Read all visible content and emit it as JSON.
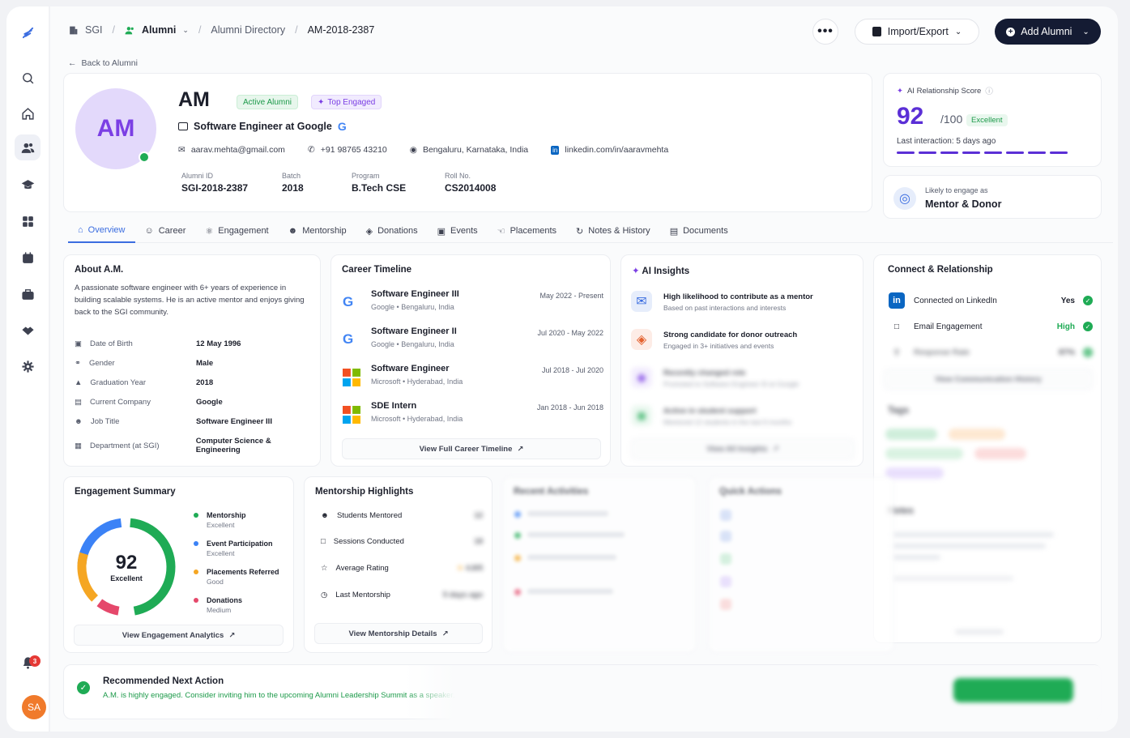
{
  "breadcrumb": {
    "org": "SGI",
    "section": "Alumni",
    "directory": "Alumni Directory",
    "current": "AM-2018-2387"
  },
  "toolbar": {
    "more": "•••",
    "import_export": "Import/Export",
    "add": "Add Alumni"
  },
  "back_label": "Back to Alumni",
  "profile": {
    "initials": "AM",
    "name": "AM",
    "badge_status": "Active Alumni",
    "badge_engaged": "Top Engaged",
    "role": "Software Engineer at Google",
    "email": "aarav.mehta@gmail.com",
    "phone": "+91 98765 43210",
    "location": "Bengaluru, Karnataka, India",
    "linkedin": "linkedin.com/in/aaravmehta",
    "meta": [
      {
        "k": "Alumni ID",
        "v": "SGI-2018-2387"
      },
      {
        "k": "Batch",
        "v": "2018"
      },
      {
        "k": "Program",
        "v": "B.Tech CSE"
      },
      {
        "k": "Roll No.",
        "v": "CS2014008"
      }
    ]
  },
  "score": {
    "label": "AI Relationship Score",
    "value": "92",
    "max": "/100",
    "rating": "Excellent",
    "last": "Last interaction: 5 days ago",
    "progress": 0.92
  },
  "likely": {
    "label": "Likely to engage as",
    "value": "Mentor & Donor"
  },
  "tabs": [
    "Overview",
    "Career",
    "Engagement",
    "Mentorship",
    "Donations",
    "Events",
    "Placements",
    "Notes & History",
    "Documents"
  ],
  "about": {
    "title": "About A.M.",
    "desc": "A passionate software engineer with 6+ years of experience in building scalable systems. He is an active mentor and enjoys giving back to the SGI community.",
    "rows": [
      {
        "k": "Date of Birth",
        "v": "12 May 1996"
      },
      {
        "k": "Gender",
        "v": "Male"
      },
      {
        "k": "Graduation Year",
        "v": "2018"
      },
      {
        "k": "Current Company",
        "v": "Google"
      },
      {
        "k": "Job Title",
        "v": "Software Engineer III"
      },
      {
        "k": "Department (at SGI)",
        "v": "Computer Science & Engineering"
      }
    ]
  },
  "career": {
    "title": "Career Timeline",
    "jobs": [
      {
        "t": "Software Engineer III",
        "co": "Google",
        "loc": "Bengaluru, India",
        "d": "May 2022 - Present"
      },
      {
        "t": "Software Engineer II",
        "co": "Google",
        "loc": "Bengaluru, India",
        "d": "Jul 2020 - May 2022"
      },
      {
        "t": "Software Engineer",
        "co": "Microsoft",
        "loc": "Hyderabad, India",
        "d": "Jul 2018 - Jul 2020"
      },
      {
        "t": "SDE Intern",
        "co": "Microsoft",
        "loc": "Hyderabad, India",
        "d": "Jan 2018 - Jun 2018"
      }
    ],
    "view": "View Full Career Timeline"
  },
  "insights": {
    "title": "AI Insights",
    "items": [
      {
        "t": "High likelihood to contribute as a mentor",
        "s": "Based on past interactions and interests"
      },
      {
        "t": "Strong candidate for donor outreach",
        "s": "Engaged in 3+ initiatives and events"
      },
      {
        "t": "Recently changed role",
        "s": "Promoted to Software Engineer III at Google"
      },
      {
        "t": "Active in student support",
        "s": "Mentored 12 students in the last 6 months"
      }
    ],
    "view": "View All Insights"
  },
  "connect": {
    "title": "Connect & Relationship",
    "rows": [
      {
        "k": "Connected on LinkedIn",
        "v": "Yes"
      },
      {
        "k": "Email Engagement",
        "v": "High"
      },
      {
        "k": "Response Rate",
        "v": "87%"
      }
    ],
    "view": "View Communication History",
    "tags_title": "Tags",
    "notes_title": "Notes"
  },
  "engagement": {
    "title": "Engagement Summary",
    "score": "92",
    "rating": "Excellent",
    "legend": [
      {
        "t": "Mentorship",
        "s": "Excellent",
        "color": "#1fab55"
      },
      {
        "t": "Event Participation",
        "s": "Excellent",
        "color": "#3b82f6"
      },
      {
        "t": "Placements Referred",
        "s": "Good",
        "color": "#f5a623"
      },
      {
        "t": "Donations",
        "s": "Medium",
        "color": "#e5486b"
      }
    ],
    "view": "View Engagement Analytics"
  },
  "mentorship": {
    "title": "Mentorship Highlights",
    "rows": [
      {
        "k": "Students Mentored",
        "v": "12"
      },
      {
        "k": "Sessions Conducted",
        "v": "18"
      },
      {
        "k": "Average Rating",
        "v": "4.8/5"
      },
      {
        "k": "Last Mentorship",
        "v": "5 days ago"
      }
    ],
    "view": "View Mentorship Details"
  },
  "recent": {
    "title": "Recent Activities",
    "quick": "Quick Actions"
  },
  "recommendation": {
    "title": "Recommended Next Action",
    "text": "A.M. is highly engaged. Consider inviting him to the upcoming Alumni Leadership Summit as a speaker."
  },
  "user": {
    "initials": "SA",
    "notifications": "3"
  }
}
